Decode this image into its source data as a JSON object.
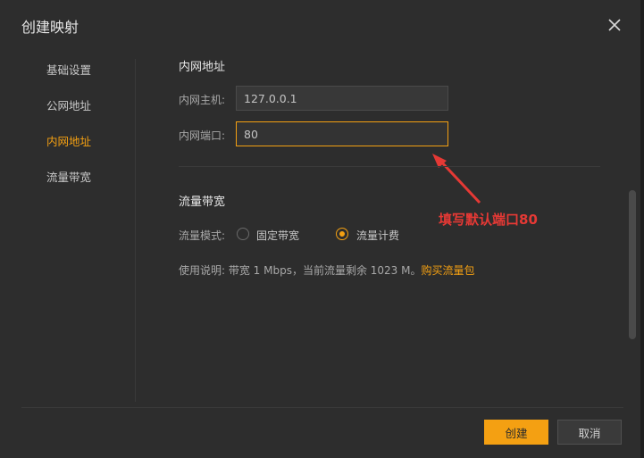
{
  "dialog": {
    "title": "创建映射",
    "close_icon": "close-icon"
  },
  "sidebar": {
    "items": [
      {
        "label": "基础设置",
        "active": false
      },
      {
        "label": "公网地址",
        "active": false
      },
      {
        "label": "内网地址",
        "active": true
      },
      {
        "label": "流量带宽",
        "active": false
      }
    ]
  },
  "intranet": {
    "section_title": "内网地址",
    "host_label": "内网主机:",
    "host_value": "127.0.0.1",
    "port_label": "内网端口:",
    "port_value": "80"
  },
  "annotation": {
    "text": "填写默认端口80",
    "color": "#e53935"
  },
  "bandwidth": {
    "section_title": "流量带宽",
    "mode_label": "流量模式:",
    "options": [
      {
        "label": "固定带宽",
        "checked": false
      },
      {
        "label": "流量计费",
        "checked": true
      }
    ],
    "desc_prefix": "使用说明:  带宽 1 Mbps，当前流量剩余 1023 M。",
    "desc_link": "购买流量包"
  },
  "footer": {
    "create_label": "创建",
    "cancel_label": "取消"
  },
  "colors": {
    "accent": "#f4a012",
    "background": "#2d2d2d"
  }
}
